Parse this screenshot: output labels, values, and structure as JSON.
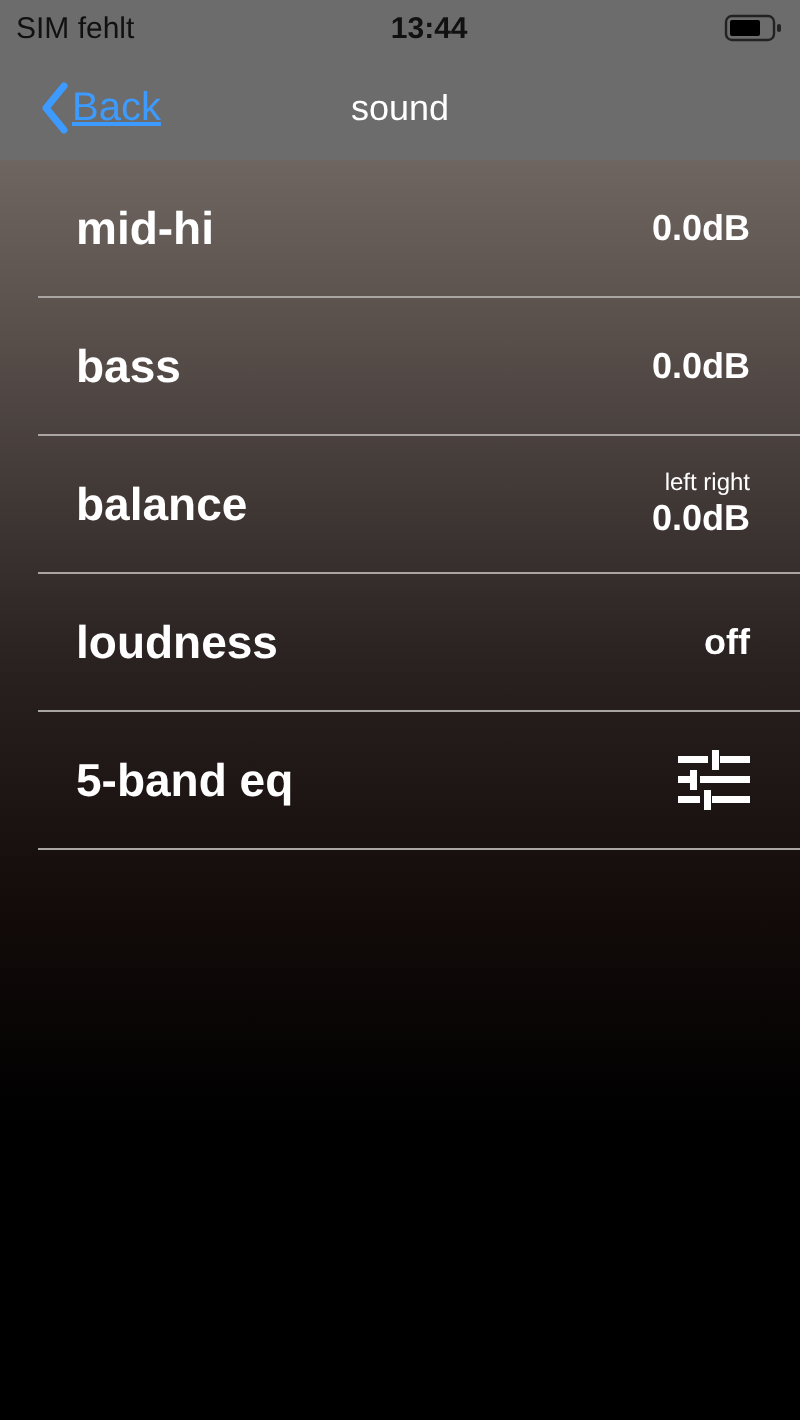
{
  "status_bar": {
    "carrier": "SIM fehlt",
    "time": "13:44"
  },
  "nav": {
    "back": "Back",
    "title": "sound"
  },
  "rows": [
    {
      "kind": "value",
      "label": "mid-hi",
      "value": "0.0dB"
    },
    {
      "kind": "value",
      "label": "bass",
      "value": "0.0dB"
    },
    {
      "kind": "value",
      "label": "balance",
      "caption": "left right",
      "value": "0.0dB"
    },
    {
      "kind": "value",
      "label": "loudness",
      "value": "off"
    },
    {
      "kind": "icon",
      "label": "5-band eq"
    }
  ]
}
